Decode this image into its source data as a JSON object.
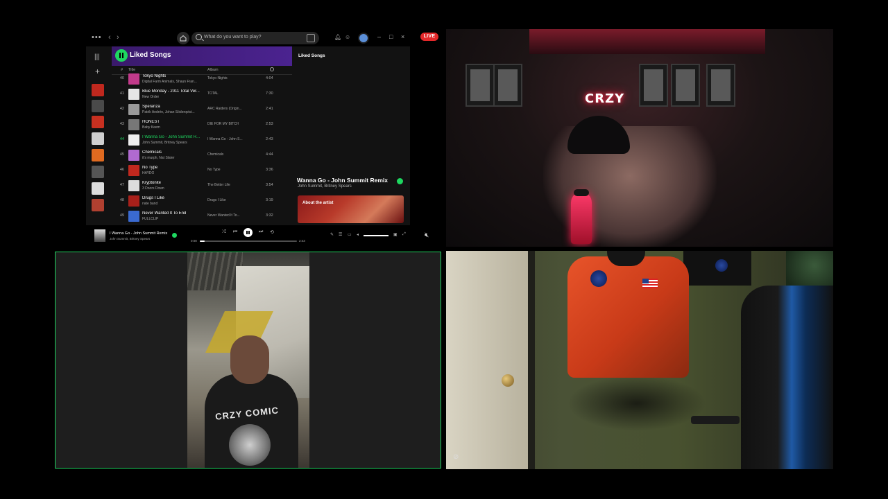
{
  "spotify": {
    "search_placeholder": "What do you want to play?",
    "library_title": "Liked Songs",
    "columns": {
      "num": "#",
      "title": "Title",
      "album": "Album"
    },
    "tracks": [
      {
        "num": "40",
        "name": "Tokyo Nights",
        "artist": "Digital Farm Animals, Shaun Fran...",
        "album": "Tokyo Nights",
        "duration": "4:04",
        "color": "#c23a8a"
      },
      {
        "num": "41",
        "name": "Blue Monday - 2011 Total Ver...",
        "artist": "New Order",
        "album": "TOTAL",
        "duration": "7:30",
        "color": "#e6e6e6"
      },
      {
        "num": "42",
        "name": "Speranza",
        "artist": "Patrik Andrén, Johan Söderqvist...",
        "album": "ARC Raiders (Origin...",
        "duration": "2:41",
        "color": "#9a9a9a"
      },
      {
        "num": "43",
        "name": "HONEST",
        "artist": "Baby Keem",
        "album": "DIE FOR MY BITCH",
        "duration": "2:53",
        "color": "#777"
      },
      {
        "num": "44",
        "name": "I Wanna Go - John Summit R...",
        "artist": "John Summit, Britney Spears",
        "album": "I Wanna Go - John S...",
        "duration": "2:43",
        "color": "#eee",
        "active": true
      },
      {
        "num": "45",
        "name": "Chemicals",
        "artist": "it's murph, Nat Slater",
        "album": "Chemicals",
        "duration": "4:44",
        "color": "#b06ad0"
      },
      {
        "num": "46",
        "name": "No Type",
        "artist": "HAYDO",
        "album": "No Type",
        "duration": "3:36",
        "color": "#c0281e"
      },
      {
        "num": "47",
        "name": "Kryptonite",
        "artist": "3 Doors Down",
        "album": "The Better Life",
        "duration": "3:54",
        "color": "#dcdcdc"
      },
      {
        "num": "48",
        "name": "Drugs I Like",
        "artist": "nate band",
        "album": "Drugs I Like",
        "duration": "3:19",
        "color": "#a8201a"
      },
      {
        "num": "49",
        "name": "Never Wanted It To End",
        "artist": "FULLCLIP",
        "album": "Never Wanted It To...",
        "duration": "3:32",
        "color": "#3a6ad0"
      }
    ],
    "right_panel": {
      "title": "Liked Songs",
      "now_playing_title": "Wanna Go - John Summit Remix",
      "now_playing_artist": "John Summit, Britney Spears",
      "about_label": "About the artist"
    },
    "player": {
      "title": "I Wanna Go - John Summit Remix",
      "artist": "John Summit, Britney Spears",
      "elapsed": "0:08",
      "total": "2:43",
      "progress": 0.05
    }
  },
  "stream": {
    "live_label": "LIVE"
  },
  "video_panels": {
    "top_right_neon_sign": "CRZY",
    "bottom_left_shirt_text": "CRZY COMIC"
  }
}
